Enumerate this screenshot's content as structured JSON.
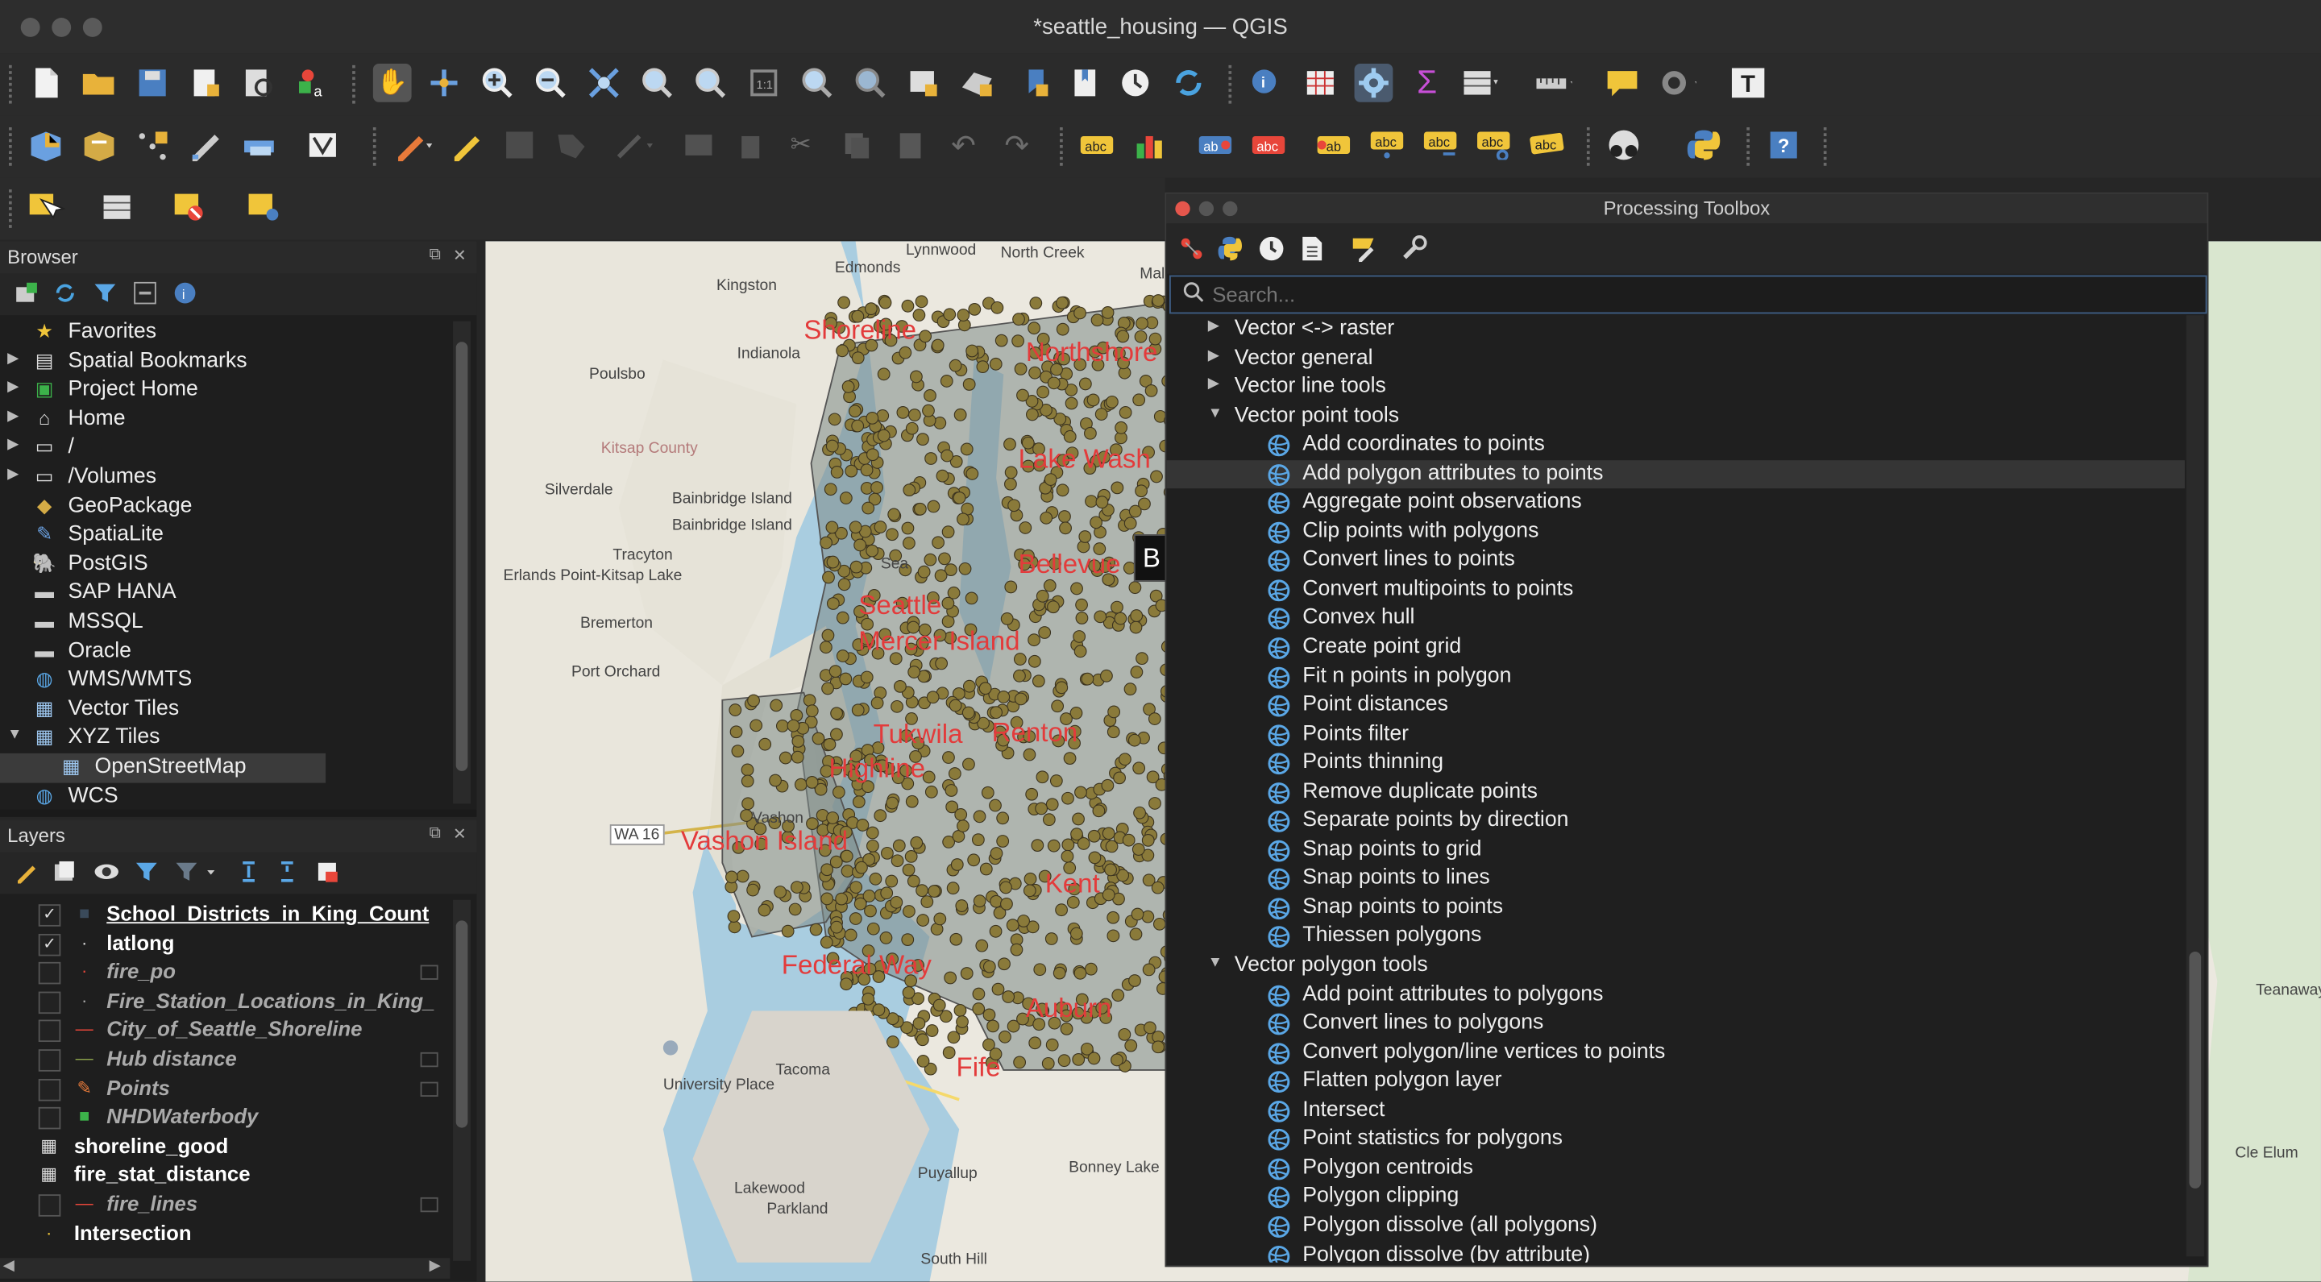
{
  "window": {
    "title": "*seattle_housing — QGIS"
  },
  "browser": {
    "title": "Browser",
    "items": [
      {
        "label": "Favorites",
        "icon": "star-icon",
        "arrow": ""
      },
      {
        "label": "Spatial Bookmarks",
        "icon": "bookmark-icon",
        "arrow": "▶"
      },
      {
        "label": "Project Home",
        "icon": "project-home-icon",
        "arrow": "▶"
      },
      {
        "label": "Home",
        "icon": "home-icon",
        "arrow": "▶"
      },
      {
        "label": "/",
        "icon": "folder-icon",
        "arrow": "▶"
      },
      {
        "label": "/Volumes",
        "icon": "folder-icon",
        "arrow": "▶"
      },
      {
        "label": "GeoPackage",
        "icon": "geopackage-icon",
        "arrow": ""
      },
      {
        "label": "SpatiaLite",
        "icon": "spatialite-icon",
        "arrow": ""
      },
      {
        "label": "PostGIS",
        "icon": "postgis-icon",
        "arrow": ""
      },
      {
        "label": "SAP HANA",
        "icon": "database-icon",
        "arrow": ""
      },
      {
        "label": "MSSQL",
        "icon": "database-icon",
        "arrow": ""
      },
      {
        "label": "Oracle",
        "icon": "database-icon",
        "arrow": ""
      },
      {
        "label": "WMS/WMTS",
        "icon": "globe-icon",
        "arrow": ""
      },
      {
        "label": "Vector Tiles",
        "icon": "grid-icon",
        "arrow": ""
      },
      {
        "label": "XYZ Tiles",
        "icon": "grid-icon",
        "arrow": "▼"
      },
      {
        "label": "OpenStreetMap",
        "icon": "grid-icon",
        "arrow": ""
      },
      {
        "label": "WCS",
        "icon": "globe-icon",
        "arrow": ""
      }
    ]
  },
  "layers": {
    "title": "Layers",
    "items": [
      {
        "label": "School_Districts_in_King_Count",
        "checked": "✓",
        "style": "bold",
        "underline": true
      },
      {
        "label": "latlong",
        "checked": "✓",
        "style": "bold"
      },
      {
        "label": "fire_po",
        "checked": "",
        "style": "ital"
      },
      {
        "label": "Fire_Station_Locations_in_King_",
        "checked": "",
        "style": "ital"
      },
      {
        "label": "City_of_Seattle_Shoreline",
        "checked": "",
        "style": "ital"
      },
      {
        "label": "Hub distance",
        "checked": "",
        "style": "ital"
      },
      {
        "label": "Points",
        "checked": "",
        "style": "ital"
      },
      {
        "label": "NHDWaterbody",
        "checked": "",
        "style": "ital"
      },
      {
        "label": "shoreline_good",
        "checked": "",
        "style": "bold"
      },
      {
        "label": "fire_stat_distance",
        "checked": "",
        "style": "bold"
      },
      {
        "label": "fire_lines",
        "checked": "",
        "style": "ital"
      },
      {
        "label": "Intersection",
        "checked": "",
        "style": "bold"
      }
    ]
  },
  "map": {
    "labels": [
      "Shoreline",
      "Northshore",
      "Lake Wash",
      "Seattle",
      "Bellevue",
      "Mercer Island",
      "Tukwila",
      "Renton",
      "Highline",
      "Vashon Island",
      "Kent",
      "Federal Way",
      "Auburn",
      "Fife"
    ],
    "towns": [
      "Lynnwood",
      "North Creek",
      "Kingston",
      "Edmonds",
      "Maltby",
      "Indianola",
      "Poulsbo",
      "Kitsap County",
      "Bainbridge Island",
      "Bainbridge Island",
      "Silverdale",
      "Tracyton",
      "Erlands Point-Kitsap Lake",
      "Bremerton",
      "Port Orchard",
      "WA 16",
      "Vashon",
      "University Place",
      "Tacoma",
      "Lakewood",
      "Parkland",
      "Puyallup",
      "Bonney Lake",
      "South Hill",
      "Teanaway Commun Forest",
      "Cle Elum",
      "Sea"
    ],
    "overlay_letter": "B"
  },
  "toolbox": {
    "title": "Processing Toolbox",
    "search_placeholder": "Search...",
    "groups": [
      {
        "label": "Vector <-> raster",
        "expanded": false,
        "items": []
      },
      {
        "label": "Vector general",
        "expanded": false,
        "items": []
      },
      {
        "label": "Vector line tools",
        "expanded": false,
        "items": []
      },
      {
        "label": "Vector point tools",
        "expanded": true,
        "items": [
          "Add coordinates to points",
          "Add polygon attributes to points",
          "Aggregate point observations",
          "Clip points with polygons",
          "Convert lines to points",
          "Convert multipoints to points",
          "Convex hull",
          "Create point grid",
          "Fit n points in polygon",
          "Point distances",
          "Points filter",
          "Points thinning",
          "Remove duplicate points",
          "Separate points by direction",
          "Snap points to grid",
          "Snap points to lines",
          "Snap points to points",
          "Thiessen polygons"
        ]
      },
      {
        "label": "Vector polygon tools",
        "expanded": true,
        "items": [
          "Add point attributes to polygons",
          "Convert lines to polygons",
          "Convert polygon/line vertices to points",
          "Flatten polygon layer",
          "Intersect",
          "Point statistics for polygons",
          "Polygon centroids",
          "Polygon clipping",
          "Polygon dissolve (all polygons)",
          "Polygon dissolve (by attribute)"
        ]
      }
    ],
    "selected_item": "Add polygon attributes to points"
  },
  "colors": {
    "map_label": "#e33b3b",
    "water": "#a9cde0",
    "points": "#8a7a3a",
    "selection": "#353535"
  }
}
